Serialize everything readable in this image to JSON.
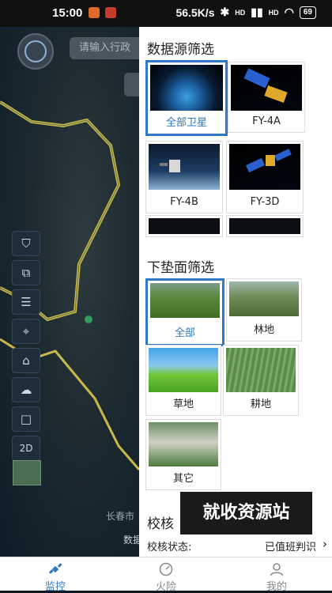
{
  "status_bar": {
    "time": "15:00",
    "net_speed": "56.5K/s",
    "signal1": "HD",
    "signal2": "HD",
    "battery": "69"
  },
  "map": {
    "search_placeholder": "请输入行政",
    "city_label": "长春市",
    "bottom_label": "数据",
    "tools": [
      {
        "name": "filter-icon",
        "glyph": "⛉"
      },
      {
        "name": "layers-icon",
        "glyph": "⧉"
      },
      {
        "name": "list-icon",
        "glyph": "☰"
      },
      {
        "name": "locate-icon",
        "glyph": "⌖"
      },
      {
        "name": "home-icon",
        "glyph": "⌂"
      },
      {
        "name": "cloud-icon",
        "glyph": "☁"
      },
      {
        "name": "square-icon",
        "glyph": "□"
      },
      {
        "name": "2d-toggle",
        "glyph": "2D"
      }
    ]
  },
  "panel": {
    "data_source_title": "数据源筛选",
    "data_sources": [
      {
        "label": "全部卫星",
        "selected": true
      },
      {
        "label": "FY-4A",
        "selected": false
      },
      {
        "label": "FY-4B",
        "selected": false
      },
      {
        "label": "FY-3D",
        "selected": false
      }
    ],
    "surface_title": "下垫面筛选",
    "surfaces": [
      {
        "label": "全部",
        "selected": true
      },
      {
        "label": "林地",
        "selected": false
      },
      {
        "label": "草地",
        "selected": false
      },
      {
        "label": "耕地",
        "selected": false
      },
      {
        "label": "其它",
        "selected": false
      }
    ],
    "verify_title": "校核",
    "verify_label": "校核状态:",
    "verify_value": "已值班判识"
  },
  "watermark": "就收资源站",
  "tabs": [
    {
      "label": "监控",
      "active": true
    },
    {
      "label": "火险",
      "active": false
    },
    {
      "label": "我的",
      "active": false
    }
  ],
  "colors": {
    "accent": "#2f78c4",
    "boundary": "#c9b84a"
  }
}
